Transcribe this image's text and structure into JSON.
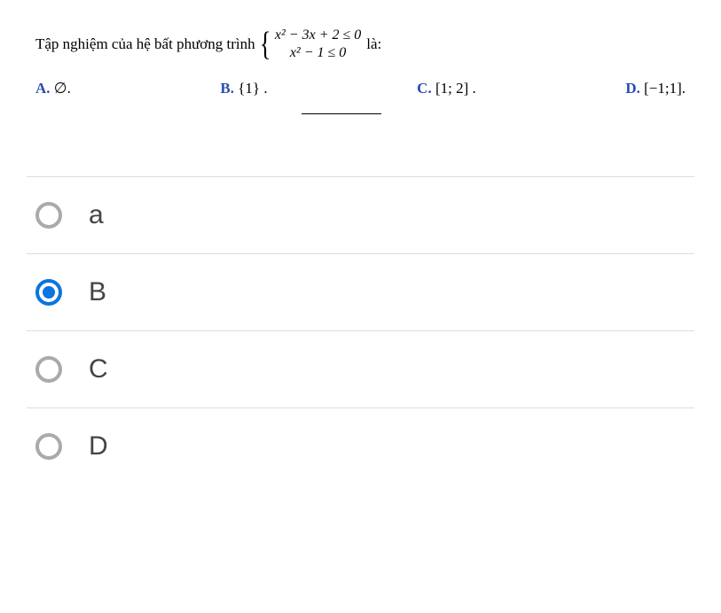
{
  "question": {
    "prefix": "Tập nghiệm của hệ bất phương trình",
    "system_line1": "x² − 3x + 2 ≤ 0",
    "system_line2": "x² − 1 ≤ 0",
    "suffix": "là:"
  },
  "choices": {
    "a": {
      "label": "A.",
      "value": "∅."
    },
    "b": {
      "label": "B.",
      "value": "{1} ."
    },
    "c": {
      "label": "C.",
      "value": "[1; 2] ."
    },
    "d": {
      "label": "D.",
      "value": "[−1;1]."
    }
  },
  "answers": [
    {
      "key": "a",
      "text": "a",
      "selected": false
    },
    {
      "key": "b",
      "text": "B",
      "selected": true
    },
    {
      "key": "c",
      "text": "C",
      "selected": false
    },
    {
      "key": "d",
      "text": "D",
      "selected": false
    }
  ]
}
